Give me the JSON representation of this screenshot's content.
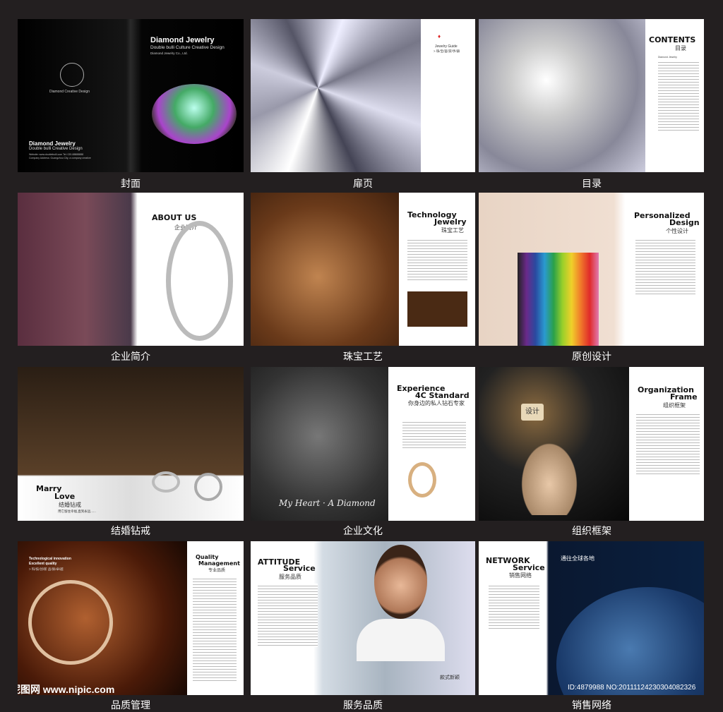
{
  "captions": [
    "封面",
    "扉页",
    "目录",
    "企业简介",
    "珠宝工艺",
    "原创设计",
    "结婚钻戒",
    "企业文化",
    "组织框架",
    "品质管理",
    "服务品质",
    "销售网络"
  ],
  "cover": {
    "title": "Diamond Jewelry",
    "subtitle": "Double bulli Culture Creative Design",
    "company": "Diamond Jewelry Co., Ltd.",
    "logo_text": "Diamond  Creative Design",
    "back_title": "Diamond Jewelry",
    "back_subtitle": "Double bulli Creative Design",
    "back_info": "Website: www.doublebulli.com  Tel: 020-88888888  Company Address: Guangzhou City, a company creative"
  },
  "flyleaf": {
    "guide": "Jewelry Guide",
    "guide_cn": "> 珠/宝/鉴/赏/手/册"
  },
  "contents": {
    "title": "CONTENTS",
    "cn": "目录",
    "item": "Diamond Jewelry"
  },
  "about": {
    "title": "ABOUT US",
    "cn": "企业简介"
  },
  "tech": {
    "title1": "Technology",
    "title2": "Jewelry",
    "cn": "珠宝工艺"
  },
  "personal": {
    "title1": "Personalized",
    "title2": "Design",
    "cn": "个性设计"
  },
  "marry": {
    "title1": "Marry",
    "title2": "Love",
    "cn": "结婚钻戒",
    "tagline": "用它留住幸福,直到永远......"
  },
  "culture": {
    "script": "My Heart · A Diamond",
    "title1": "Experience",
    "title2": "4C Standard",
    "cn": "你身边的私人钻石专家"
  },
  "org": {
    "title1": "Organization",
    "title2": "Frame",
    "cn": "组织框架",
    "button": "设计"
  },
  "quality": {
    "line1": "Technological innovation",
    "line2": "Excellent quality",
    "line3": "> 科/技/创/新  品/质/卓/越",
    "title1": "Quality",
    "title2": "Management",
    "cn": "专业品质"
  },
  "service": {
    "title1": "ATTITUDE",
    "title2": "Service",
    "cn": "服务品质",
    "footer": "款式新颖"
  },
  "network": {
    "title1": "NETWORK",
    "title2": "Service",
    "cn": "销售网络",
    "globe": "通往全球各地"
  },
  "watermark": {
    "site": "昵图网 www.nipic.com",
    "id": "ID:4879988 NO:20111124230304082326"
  }
}
